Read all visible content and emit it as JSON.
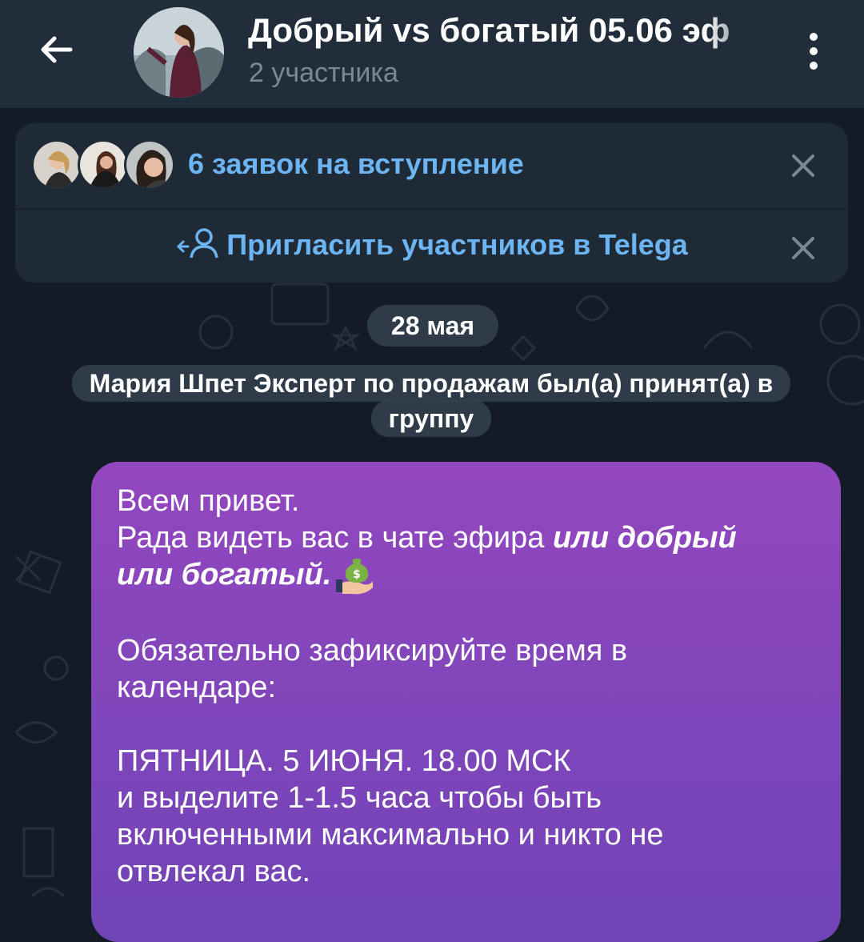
{
  "header": {
    "title": "Добрый vs богатый 05.06 эф",
    "subtitle": "2 участника",
    "back_icon": "arrow-left-icon",
    "menu_icon": "more-vertical-icon"
  },
  "join_requests": {
    "label": "6 заявок на вступление",
    "close_icon": "close-icon"
  },
  "invite": {
    "label": "Пригласить участников в Telega",
    "icon": "add-user-icon",
    "close_icon": "close-icon"
  },
  "date_separator": "28 мая",
  "service_message": "Мария Шпет Эксперт по продажам был(а) принят(а) в группу",
  "message": {
    "line1": "Всем привет.",
    "line2_plain": "Рада видеть вас в чате эфира ",
    "line2_emph": "или добрый",
    "line3_emph": "или богатый.",
    "emoji": "money-bag-hand-icon",
    "line4": "Обязательно зафиксируйте время в",
    "line5": "календаре:",
    "line6": "ПЯТНИЦА. 5 ИЮНЯ. 18.00 МСК",
    "line7": "и выделите 1-1.5 часа чтобы быть",
    "line8": "включенными максимально и никто не",
    "line9": "отвлекал вас."
  },
  "colors": {
    "header_bg": "#212d3b",
    "link_blue": "#6cb4f2",
    "bubble_top": "#9347bf",
    "bubble_bottom": "#7044b6"
  }
}
